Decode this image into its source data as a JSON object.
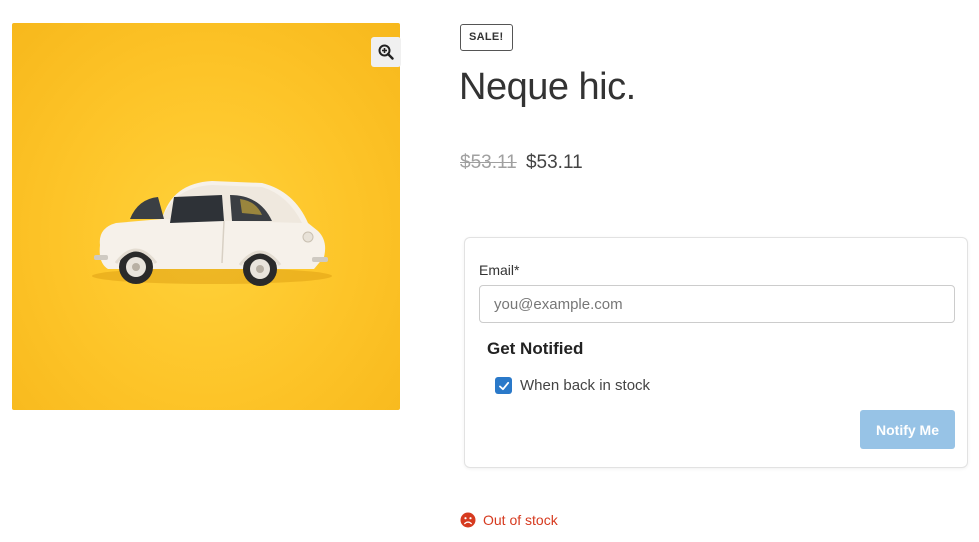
{
  "product": {
    "image_alt": "White toy car on yellow background",
    "sale_badge": "SALE!",
    "title": "Neque hic.",
    "price_old": "$53.11",
    "price_new": "$53.11",
    "stock_status": "Out of stock"
  },
  "notify_form": {
    "email_label": "Email*",
    "email_placeholder": "you@example.com",
    "heading": "Get Notified",
    "checkbox_label": "When back in stock",
    "checkbox_checked": true,
    "submit_label": "Notify Me"
  },
  "icons": {
    "zoom": "zoom-in-icon",
    "stock": "sad-face-icon",
    "check": "checkmark-icon"
  },
  "colors": {
    "image_background": "#fdc428",
    "checkbox": "#2a79c9",
    "button": "#97c3e6",
    "out_of_stock": "#d63a1f"
  }
}
